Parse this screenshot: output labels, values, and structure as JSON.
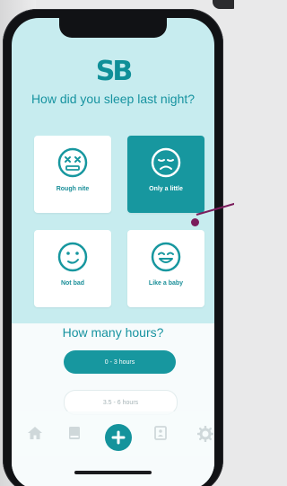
{
  "app": {
    "logo_text": "SB",
    "question": "How did you sleep last night?"
  },
  "sleep_options": [
    {
      "label": "Rough nite",
      "icon": "dizzy-face-icon",
      "selected": false
    },
    {
      "label": "Only a little",
      "icon": "sad-face-icon",
      "selected": true
    },
    {
      "label": "Not bad",
      "icon": "smirk-face-icon",
      "selected": false
    },
    {
      "label": "Like a baby",
      "icon": "happy-face-icon",
      "selected": false
    }
  ],
  "hours": {
    "title": "How many hours?",
    "options": [
      "0 - 3 hours",
      "3.5 - 6 hours"
    ],
    "selected_index": 0
  },
  "tabbar": {
    "items": [
      "home-icon",
      "book-icon",
      "add-icon",
      "contact-card-icon",
      "settings-icon"
    ]
  },
  "colors": {
    "accent": "#17979f",
    "background": "#c7ecef",
    "callout": "#7b1c5c"
  }
}
